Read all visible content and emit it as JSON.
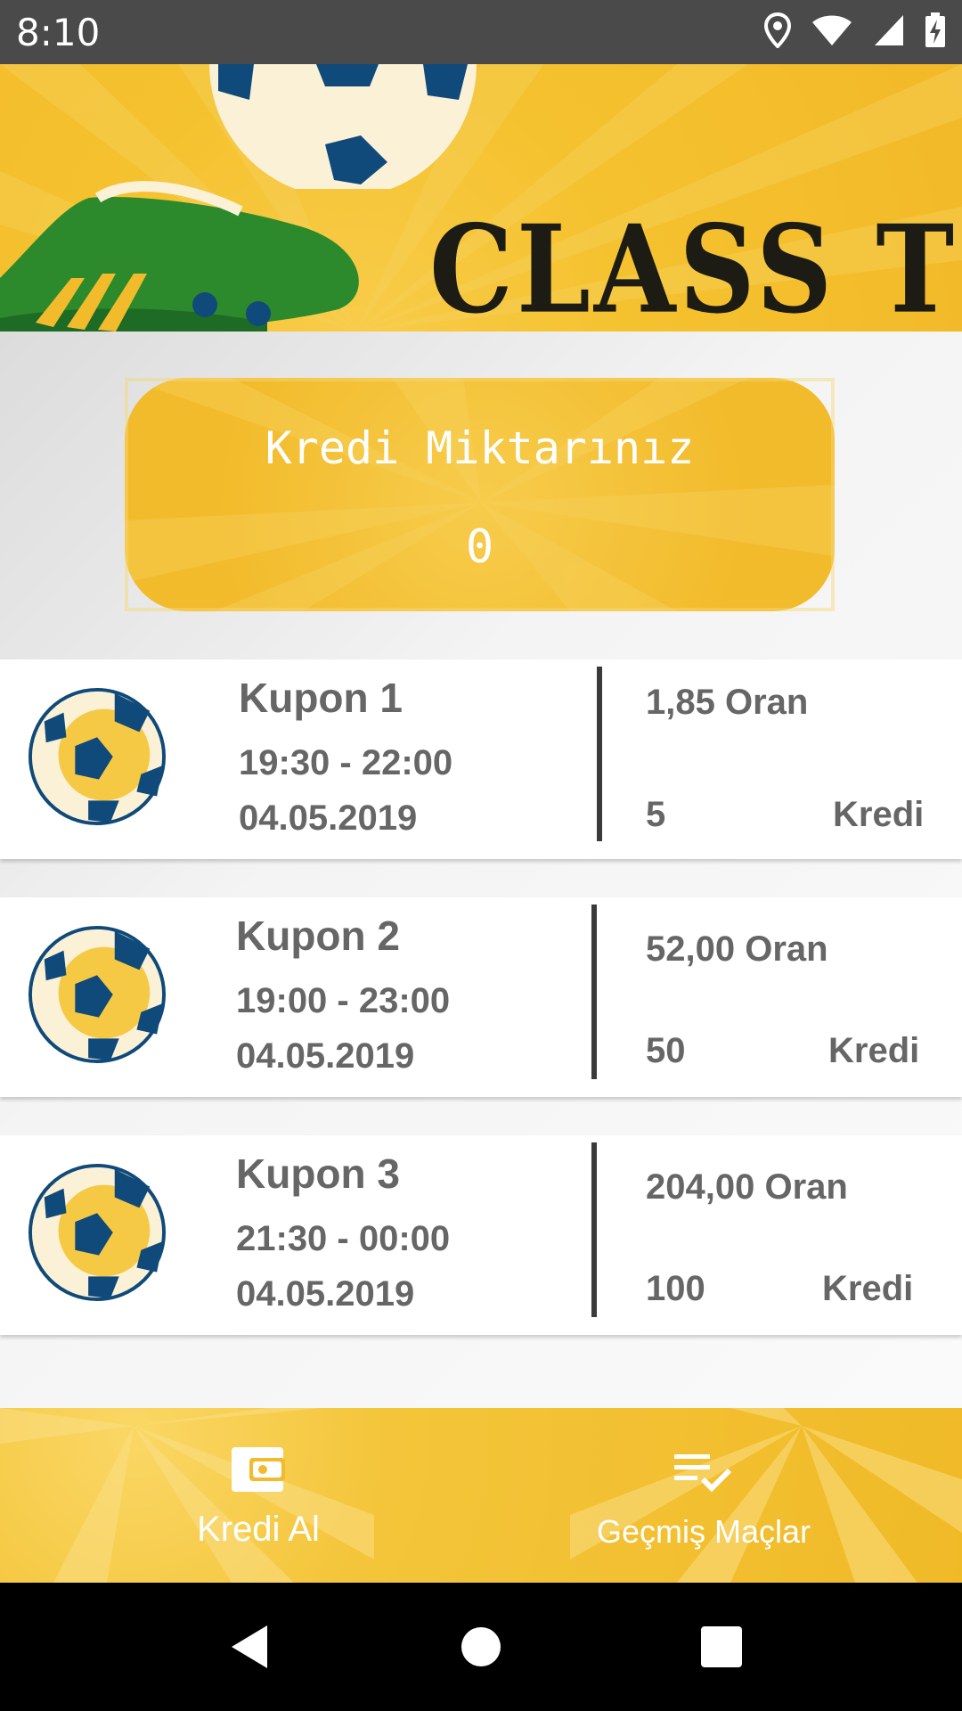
{
  "status_bar": {
    "time": "8:10"
  },
  "banner": {
    "title": "CLASS TIPS"
  },
  "credit": {
    "title": "Kredi Miktarınız",
    "value": "0"
  },
  "coupons": [
    {
      "name": "Kupon 1",
      "time": "19:30 - 22:00",
      "date": "04.05.2019",
      "odds": "1,85 Oran",
      "price": "5",
      "unit": "Kredi"
    },
    {
      "name": "Kupon 2",
      "time": "19:00 - 23:00",
      "date": "04.05.2019",
      "odds": "52,00 Oran",
      "price": "50",
      "unit": "Kredi"
    },
    {
      "name": "Kupon 3",
      "time": "21:30 - 00:00",
      "date": "04.05.2019",
      "odds": "204,00 Oran",
      "price": "100",
      "unit": "Kredi"
    }
  ],
  "bottom_nav": {
    "items": [
      {
        "label": "Kredi Al",
        "icon": "wallet-icon"
      },
      {
        "label": "Geçmiş Maçlar",
        "icon": "playlist-check-icon"
      }
    ]
  },
  "colors": {
    "accent": "#f2bb2b",
    "ball_blue": "#0f4a7a",
    "text_gray": "#666666"
  }
}
